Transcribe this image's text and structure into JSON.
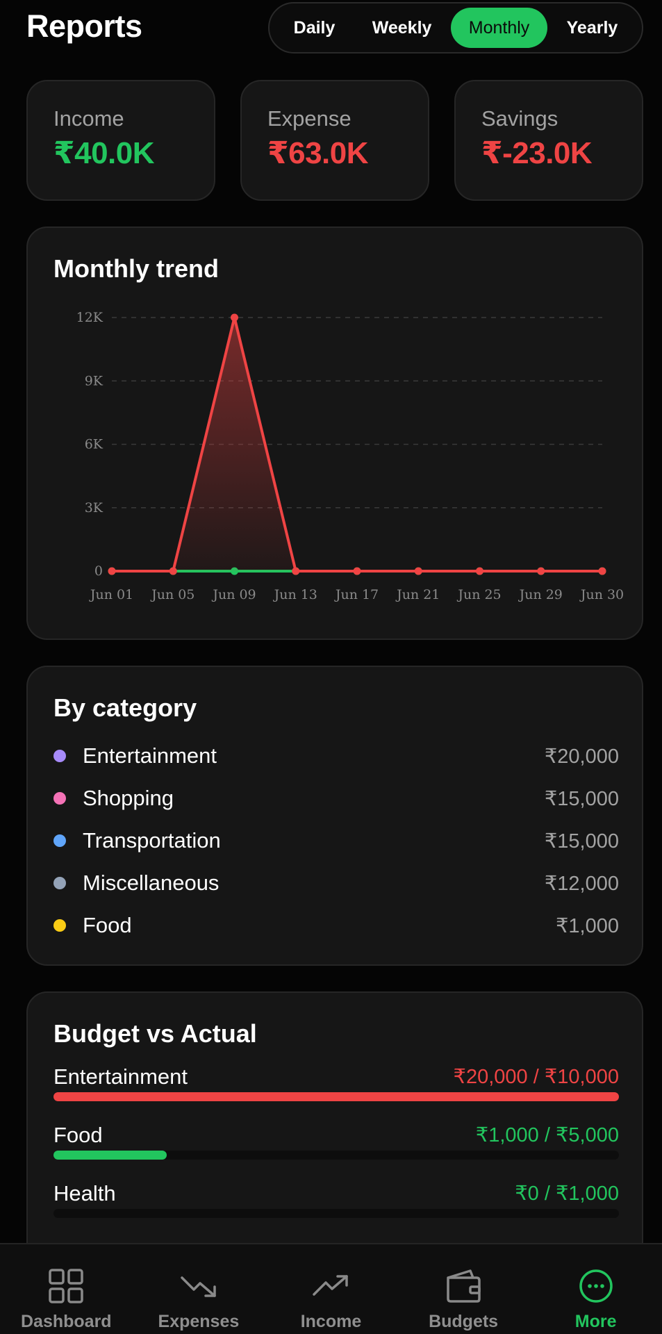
{
  "header": {
    "title": "Reports",
    "periods": [
      "Daily",
      "Weekly",
      "Monthly",
      "Yearly"
    ],
    "active_period": "Monthly"
  },
  "summary": {
    "income": {
      "label": "Income",
      "value": "₹40.0K"
    },
    "expense": {
      "label": "Expense",
      "value": "₹63.0K"
    },
    "savings": {
      "label": "Savings",
      "value": "₹-23.0K"
    }
  },
  "trend": {
    "title": "Monthly trend"
  },
  "chart_data": {
    "type": "line",
    "title": "Monthly trend",
    "x": [
      "Jun 01",
      "Jun 05",
      "Jun 09",
      "Jun 13",
      "Jun 17",
      "Jun 21",
      "Jun 25",
      "Jun 29",
      "Jun 30"
    ],
    "y_ticks": [
      "0",
      "3K",
      "6K",
      "9K",
      "12K"
    ],
    "ylim": [
      0,
      12000
    ],
    "grid": true,
    "series": [
      {
        "color": "#22c55e",
        "values": [
          0,
          0,
          0,
          0,
          0,
          0,
          0,
          0,
          0
        ]
      },
      {
        "color": "#ef4444",
        "values": [
          0,
          0,
          12000,
          0,
          0,
          0,
          0,
          0,
          0
        ],
        "fill": true
      }
    ]
  },
  "categories": {
    "title": "By category",
    "items": [
      {
        "name": "Entertainment",
        "amount": "₹20,000",
        "color": "#a78bfa"
      },
      {
        "name": "Shopping",
        "amount": "₹15,000",
        "color": "#f472b6"
      },
      {
        "name": "Transportation",
        "amount": "₹15,000",
        "color": "#60a5fa"
      },
      {
        "name": "Miscellaneous",
        "amount": "₹12,000",
        "color": "#94a3b8"
      },
      {
        "name": "Food",
        "amount": "₹1,000",
        "color": "#facc15"
      }
    ]
  },
  "budget": {
    "title": "Budget vs Actual",
    "items": [
      {
        "name": "Entertainment",
        "amount": "₹20,000 / ₹10,000",
        "progress": 1.0,
        "color": "#ef4444"
      },
      {
        "name": "Food",
        "amount": "₹1,000 / ₹5,000",
        "progress": 0.2,
        "color": "#22c55e"
      },
      {
        "name": "Health",
        "amount": "₹0 / ₹1,000",
        "progress": 0.0,
        "color": "#22c55e"
      }
    ]
  },
  "nav": {
    "items": [
      {
        "label": "Dashboard",
        "icon": "grid-icon"
      },
      {
        "label": "Expenses",
        "icon": "trending-down-icon"
      },
      {
        "label": "Income",
        "icon": "trending-up-icon"
      },
      {
        "label": "Budgets",
        "icon": "wallet-icon"
      },
      {
        "label": "More",
        "icon": "more-circle-icon"
      }
    ],
    "active": "More"
  }
}
